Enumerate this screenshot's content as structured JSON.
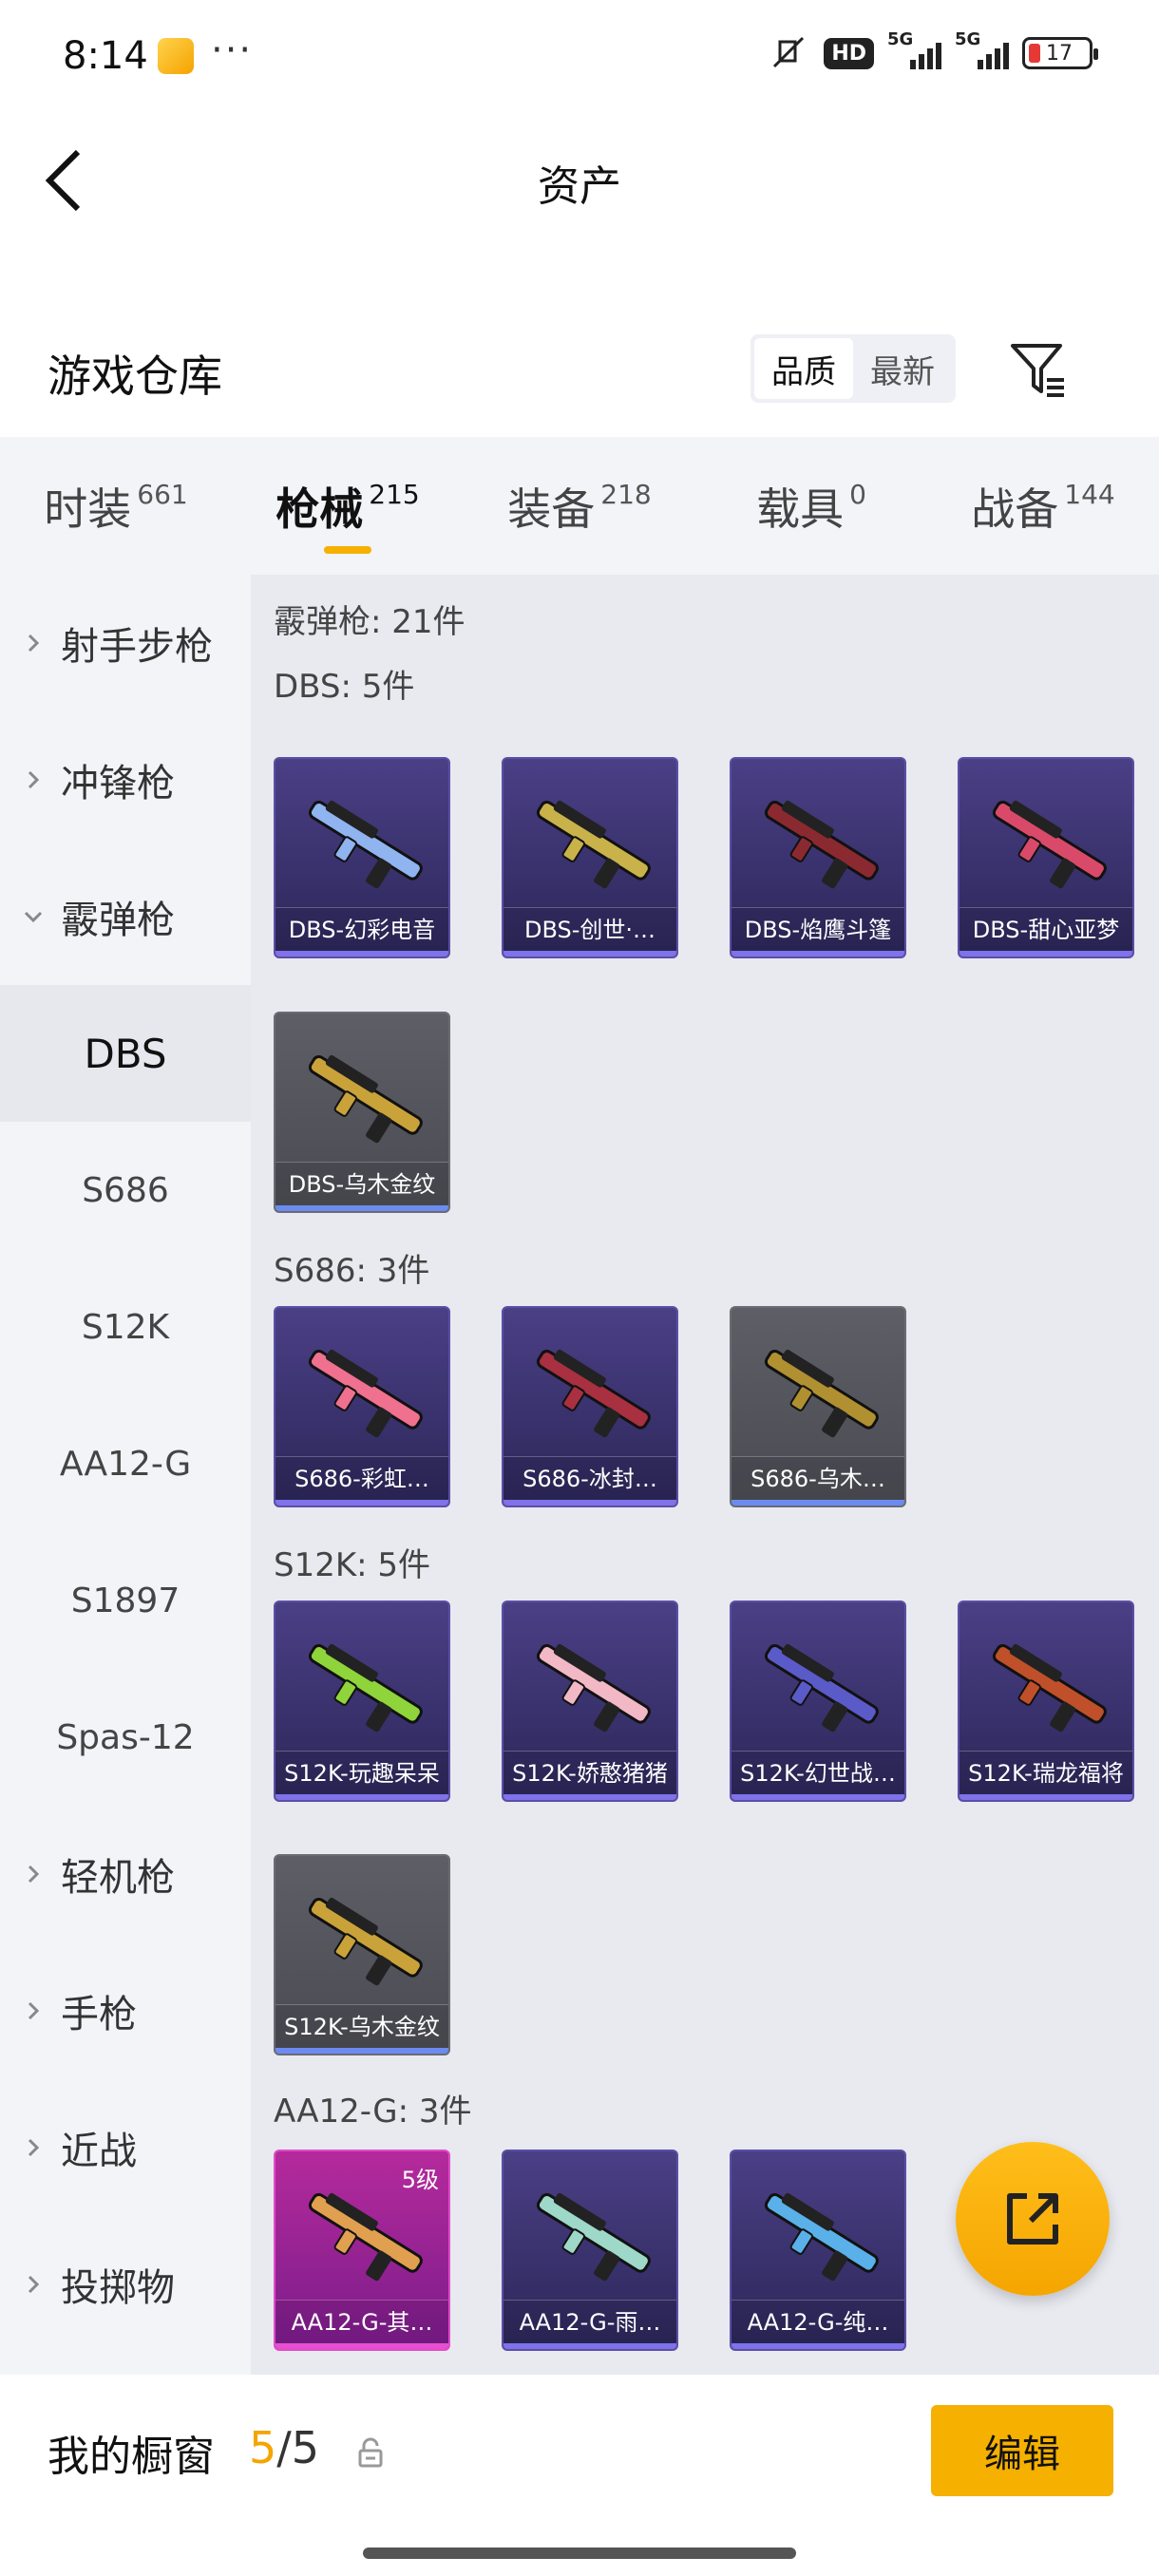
{
  "status_bar": {
    "time": "8:14",
    "more": "···",
    "hd": "HD",
    "net1": "5G",
    "net2": "5G",
    "battery": "17"
  },
  "header": {
    "title": "资产"
  },
  "section": {
    "title": "游戏仓库",
    "sort_options": [
      "品质",
      "最新"
    ],
    "sort_selected": "品质"
  },
  "tabs": [
    {
      "label": "时装",
      "count": "661"
    },
    {
      "label": "枪械",
      "count": "215",
      "active": true
    },
    {
      "label": "装备",
      "count": "218"
    },
    {
      "label": "载具",
      "count": "0"
    },
    {
      "label": "战备",
      "count": "144"
    }
  ],
  "sidebar": {
    "items": [
      {
        "label": "射手步枪",
        "type": "category",
        "expanded": false
      },
      {
        "label": "冲锋枪",
        "type": "category",
        "expanded": false
      },
      {
        "label": "霰弹枪",
        "type": "category",
        "expanded": true
      },
      {
        "label": "DBS",
        "type": "sub",
        "active": true
      },
      {
        "label": "S686",
        "type": "sub"
      },
      {
        "label": "S12K",
        "type": "sub"
      },
      {
        "label": "AA12-G",
        "type": "sub"
      },
      {
        "label": "S1897",
        "type": "sub"
      },
      {
        "label": "Spas-12",
        "type": "sub"
      },
      {
        "label": "轻机枪",
        "type": "category",
        "expanded": false
      },
      {
        "label": "手枪",
        "type": "category",
        "expanded": false
      },
      {
        "label": "近战",
        "type": "category",
        "expanded": false
      },
      {
        "label": "投掷物",
        "type": "category",
        "expanded": false
      }
    ]
  },
  "content": {
    "summary": "霰弹枪: 21件",
    "groups": [
      {
        "title": "DBS: 5件",
        "items": [
          {
            "name": "DBS-幻彩电音",
            "rarity": "purple",
            "gun_color": "#8fb4f0"
          },
          {
            "name": "DBS-创世·…",
            "rarity": "purple",
            "gun_color": "#c9b24a"
          },
          {
            "name": "DBS-焰鹰斗篷",
            "rarity": "purple",
            "gun_color": "#8a2a30"
          },
          {
            "name": "DBS-甜心亚梦",
            "rarity": "purple",
            "gun_color": "#d94a6a"
          },
          {
            "name": "DBS-乌木金纹",
            "rarity": "gray",
            "gun_color": "#c9a23a"
          }
        ]
      },
      {
        "title": "S686: 3件",
        "items": [
          {
            "name": "S686-彩虹…",
            "rarity": "purple",
            "gun_color": "#f07090"
          },
          {
            "name": "S686-冰封…",
            "rarity": "purple",
            "gun_color": "#a83040"
          },
          {
            "name": "S686-乌木…",
            "rarity": "gray",
            "gun_color": "#b09030"
          }
        ]
      },
      {
        "title": "S12K: 5件",
        "items": [
          {
            "name": "S12K-玩趣呆呆",
            "rarity": "purple",
            "gun_color": "#8fd43a"
          },
          {
            "name": "S12K-娇憨猪猪",
            "rarity": "purple",
            "gun_color": "#f2b8c6"
          },
          {
            "name": "S12K-幻世战…",
            "rarity": "purple",
            "gun_color": "#5a5ac8"
          },
          {
            "name": "S12K-瑞龙福将",
            "rarity": "purple",
            "gun_color": "#c0502a"
          },
          {
            "name": "S12K-乌木金纹",
            "rarity": "gray",
            "gun_color": "#c9a23a"
          }
        ]
      },
      {
        "title": "AA12-G: 3件",
        "items": [
          {
            "name": "AA12-G-其…",
            "rarity": "pink",
            "gun_color": "#e0a050",
            "level": "5级"
          },
          {
            "name": "AA12-G-雨…",
            "rarity": "purple",
            "gun_color": "#9ed8c8"
          },
          {
            "name": "AA12-G-纯…",
            "rarity": "purple",
            "gun_color": "#5ab0e8"
          }
        ]
      }
    ]
  },
  "bottom": {
    "label": "我的橱窗",
    "current": "5",
    "separator": "/",
    "total": "5",
    "edit_label": "编辑"
  }
}
